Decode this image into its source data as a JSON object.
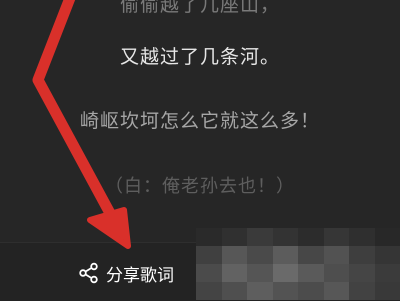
{
  "lyrics": {
    "lines": [
      "偷偷越了几座山，",
      "又越过了几条河。",
      "崎岖坎坷怎么它就这么多！",
      "（白：俺老孙去也！）"
    ]
  },
  "bottom_bar": {
    "share_label": "分享歌词",
    "share_icon": "share-icon"
  },
  "annotation": {
    "arrow_color": "#d9302a"
  },
  "colors": {
    "background": "#262626",
    "active_lyric": "#e6e6e6",
    "inactive_lyric": "#a6a6a6"
  }
}
